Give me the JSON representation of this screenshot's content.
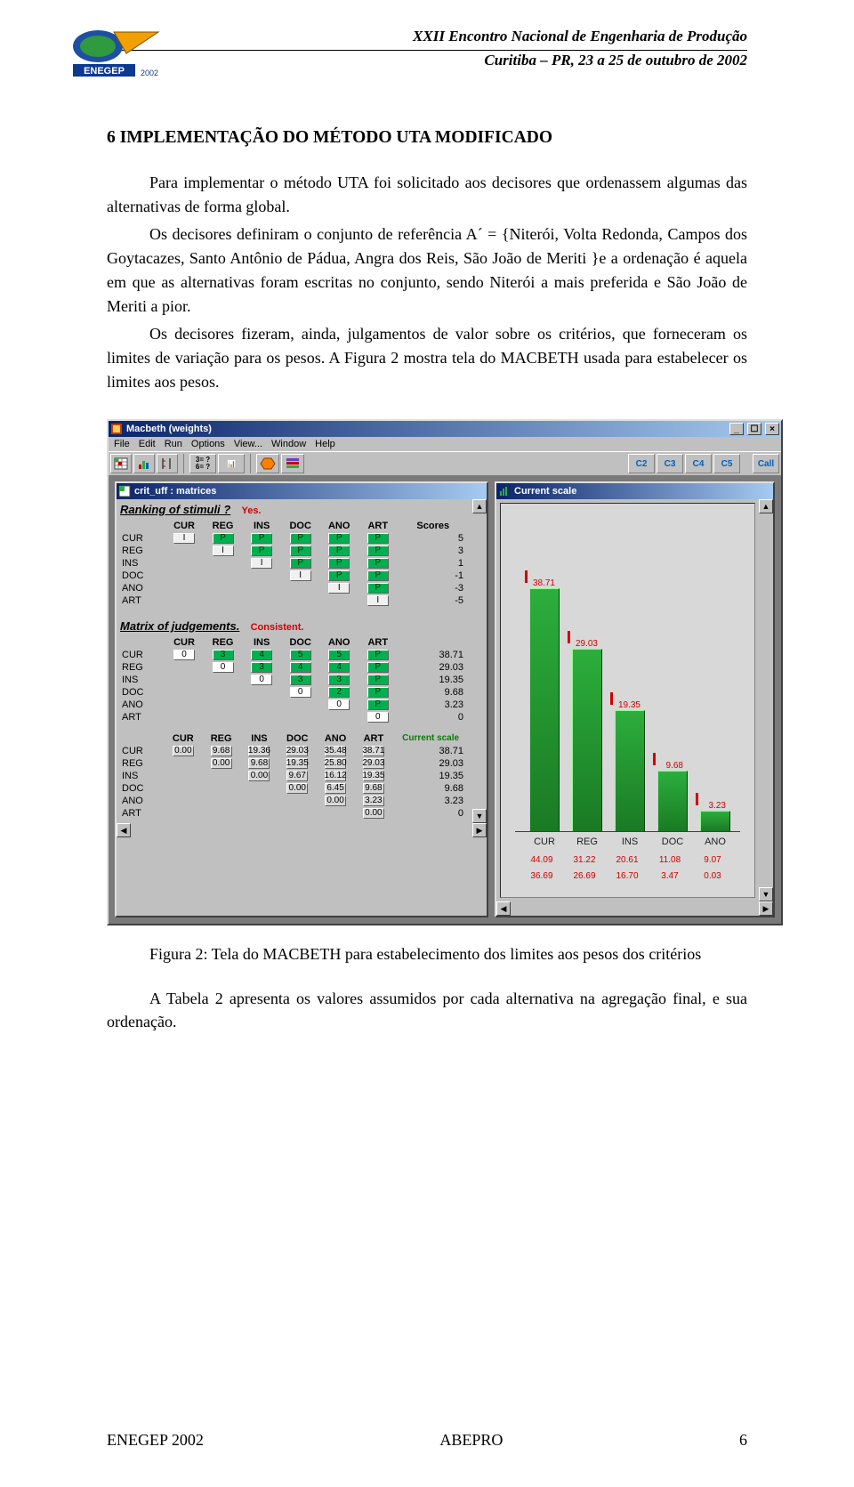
{
  "header": {
    "line1": "XXII Encontro Nacional de Engenharia de Produção",
    "line2": "Curitiba – PR, 23 a 25 de outubro de 2002",
    "logo_alt": "ENEGEP 2002"
  },
  "section_heading": "6 IMPLEMENTAÇÃO DO MÉTODO UTA MODIFICADO",
  "para1": "Para implementar o método UTA foi solicitado aos decisores que ordenassem algumas das alternativas de forma global.",
  "para2": "Os decisores definiram o conjunto de referência A´ = {Niterói, Volta Redonda, Campos dos Goytacazes, Santo Antônio de Pádua, Angra dos Reis, São João de Meriti }e a ordenação é aquela em que as alternativas foram escritas no conjunto, sendo Niterói a mais preferida e São João de Meriti a pior.",
  "para3": "Os decisores fizeram, ainda, julgamentos de valor sobre os critérios, que forneceram os limites de variação para os pesos. A Figura 2 mostra tela do MACBETH usada para estabelecer os limites aos pesos.",
  "caption": "Figura 2: Tela do MACBETH para estabelecimento dos limites aos pesos dos critérios",
  "para_after": "A Tabela 2 apresenta os valores assumidos por cada alternativa na agregação final, e sua ordenação.",
  "footer_left": "ENEGEP 2002",
  "footer_center": "ABEPRO",
  "footer_right": "6",
  "win": {
    "title": "Macbeth (weights)",
    "menus": [
      "File",
      "Edit",
      "Run",
      "Options",
      "View...",
      "Window",
      "Help"
    ],
    "toolbar_icons": [
      "grid-icon",
      "chart-icon",
      "pivot-icon"
    ],
    "toolbar_icons2": [
      "hexgrid-icon",
      "category-icon"
    ],
    "dim_buttons": [
      "C2",
      "C3",
      "C4",
      "C5"
    ],
    "all_button": "Call",
    "win_buttons": [
      "min",
      "max",
      "close"
    ],
    "left_child_title": "crit_uff : matrices",
    "right_child_title": "Current scale",
    "ranking_label": "Ranking of stimuli ?",
    "ranking_answer": "Yes.",
    "col_headers": [
      "CUR",
      "REG",
      "INS",
      "DOC",
      "ANO",
      "ART"
    ],
    "scores_label": "Scores",
    "ranking_scores": [
      5,
      3,
      1,
      -1,
      -3,
      -5
    ],
    "matrix_label": "Matrix of judgements.",
    "consistent_label": "Consistent.",
    "judgement_scores": [
      38.71,
      29.03,
      19.35,
      9.68,
      3.23,
      0.0
    ],
    "judgement_rows": [
      [
        "0",
        "3",
        "4",
        "5",
        "5",
        "P"
      ],
      [
        "",
        "0",
        "3",
        "4",
        "4",
        "P"
      ],
      [
        "",
        "",
        "0",
        "3",
        "3",
        "P"
      ],
      [
        "",
        "",
        "",
        "0",
        "2",
        "P"
      ],
      [
        "",
        "",
        "",
        "",
        "0",
        "P"
      ],
      [
        "",
        "",
        "",
        "",
        "",
        "0"
      ]
    ],
    "current_scale_label": "Current scale",
    "lower_matrix_scores": [
      38.71,
      29.03,
      19.35,
      9.68,
      3.23,
      0.0
    ],
    "lower_matrix_rows": [
      [
        "0.00",
        "9.68",
        "19.36",
        "29.03",
        "35.48",
        "38.71"
      ],
      [
        "",
        "0.00",
        "9.68",
        "19.35",
        "25.80",
        "29.03"
      ],
      [
        "",
        "",
        "0.00",
        "9.67",
        "16.12",
        "19.35"
      ],
      [
        "",
        "",
        "",
        "0.00",
        "6.45",
        "9.68"
      ],
      [
        "",
        "",
        "",
        "",
        "0.00",
        "3.23"
      ],
      [
        "",
        "",
        "",
        "",
        "",
        "0.00"
      ]
    ]
  },
  "chart_data": {
    "type": "bar",
    "categories": [
      "CUR",
      "REG",
      "INS",
      "DOC",
      "ANO"
    ],
    "values": [
      38.71,
      29.03,
      19.35,
      9.68,
      3.23
    ],
    "red_row1": [
      44.09,
      31.22,
      20.61,
      11.08,
      9.07
    ],
    "red_row2": [
      36.69,
      26.69,
      16.7,
      3.47,
      0.03
    ],
    "ylim": [
      0,
      40
    ]
  }
}
